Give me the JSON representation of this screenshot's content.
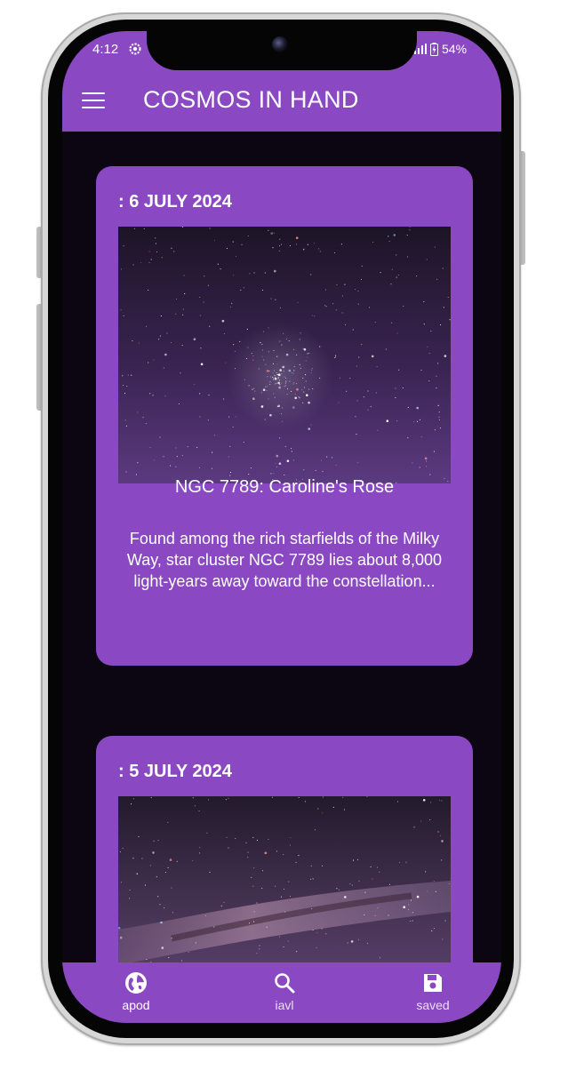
{
  "status_bar": {
    "time": "4:12",
    "battery": "54%"
  },
  "app_bar": {
    "title": "COSMOS IN HAND"
  },
  "feed": {
    "cards": [
      {
        "date": ": 6 JULY 2024",
        "title": "NGC 7789: Caroline's Rose",
        "description": "Found among the rich starfields of the Milky Way, star cluster NGC 7789 lies about 8,000 light-years away toward the constellation..."
      },
      {
        "date": ": 5 JULY 2024"
      }
    ]
  },
  "bottom_nav": {
    "items": [
      {
        "label": "apod",
        "icon": "globe-icon",
        "active": true
      },
      {
        "label": "iavl",
        "icon": "search-icon",
        "active": false
      },
      {
        "label": "saved",
        "icon": "save-icon",
        "active": false
      }
    ]
  },
  "colors": {
    "primary": "#8a48c2",
    "background": "#0c0512",
    "text": "#ffffff"
  }
}
